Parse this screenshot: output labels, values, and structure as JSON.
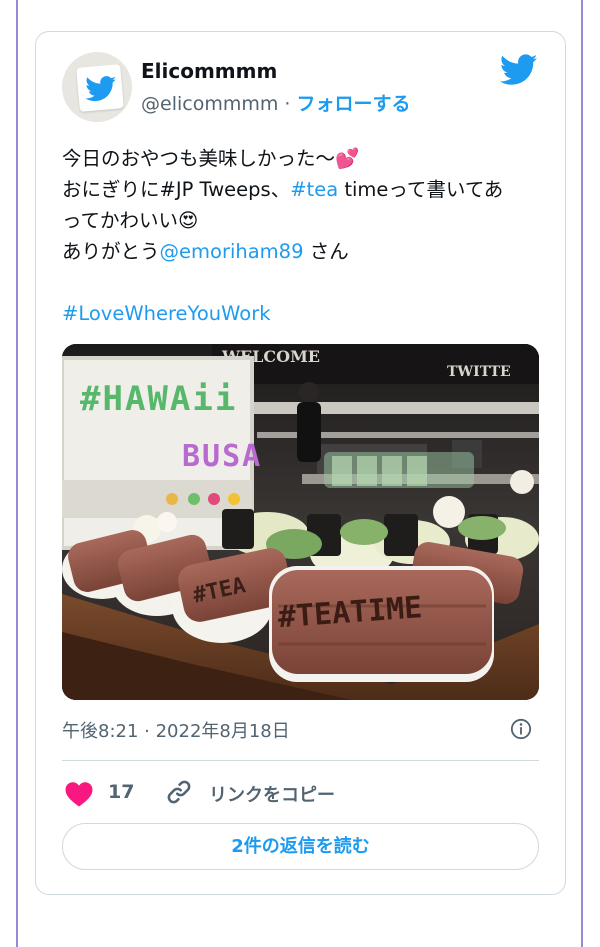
{
  "tweet": {
    "display_name": "Elicommmm",
    "handle": "@elicommmm",
    "separator": " · ",
    "follow_label": "フォローする",
    "text": {
      "line1": "今日のおやつも美味しかった〜💕",
      "line2_a": "おにぎりに#JP Tweeps、",
      "line2_tag": "#tea",
      "line2_b": " timeって書いてあ",
      "line3": "ってかわいい😍",
      "line4_a": "ありがとう",
      "line4_mention": "@emoriham89",
      "line4_b": " さん",
      "hashtag": "#LoveWhereYouWork"
    },
    "media": {
      "welcome_sign": "WELCOME",
      "twitter_sign": "TWITTE",
      "lightbox_line1": "#HAWAii",
      "lightbox_line2": "BUSA",
      "brand_mark": "#TEATIME",
      "brand_mark_small": "#TEA"
    },
    "timestamp": "午後8:21 · 2022年8月18日",
    "likes": "17",
    "copy_link_label": "リンクをコピー",
    "replies_label": "2件の返信を読む"
  },
  "colors": {
    "accent": "#1d9bf0",
    "like": "#f91880",
    "muted": "#536471",
    "border": "#cfd9de"
  },
  "icons": [
    "twitter-bird-icon",
    "info-icon",
    "heart-icon",
    "link-icon"
  ]
}
